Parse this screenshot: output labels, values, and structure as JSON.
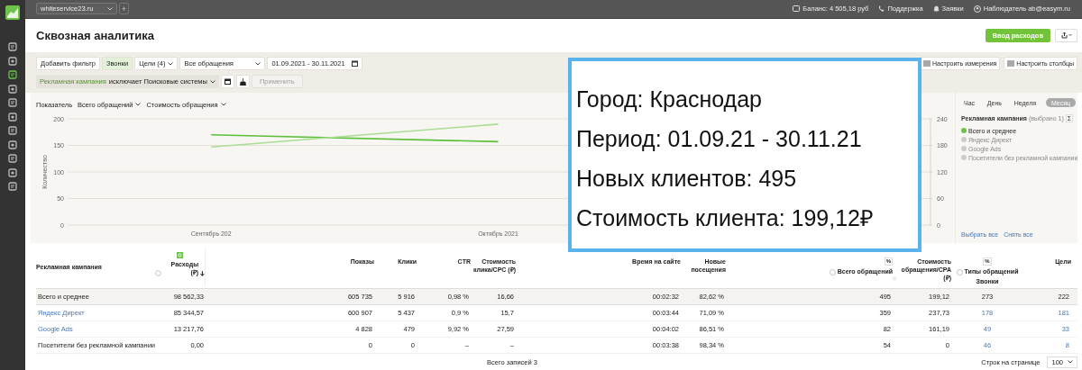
{
  "topbar": {
    "site": "whiteservice23.ru",
    "add": "+",
    "balance": "Баланс:  4 505,18 руб",
    "support": "Поддержка",
    "requests": "Заявки",
    "user": "Наблюдатель ab@easym.ru"
  },
  "sidebar": {
    "items": [
      {
        "selected": false
      },
      {
        "selected": false
      },
      {
        "selected": true
      },
      {
        "selected": false
      },
      {
        "selected": false
      },
      {
        "selected": false
      },
      {
        "selected": false
      },
      {
        "selected": false
      },
      {
        "selected": false
      },
      {
        "selected": false
      },
      {
        "selected": false
      }
    ]
  },
  "header": {
    "title": "Сквозная аналитика",
    "primary_button": "Ввод расходов"
  },
  "filters": {
    "add_filter": "Добавить фильтр",
    "calls": {
      "label": "Звонки",
      "selected": true
    },
    "goals": "Цели (4)",
    "requests_select": "Все обращения",
    "date_range": "01.09.2021 - 30.11.2021",
    "condition": {
      "field": "Рекламная кампания",
      "rest": "исключает Поисковые системы"
    },
    "apply": {
      "label": "Применить",
      "disabled": true
    },
    "configure": [
      "Настроить измерения",
      "Настроить столбцы"
    ]
  },
  "chart": {
    "indicator_label": "Показатель",
    "chart_data": {
      "type": "line",
      "ylabel": "Количество",
      "categories": [
        "Сентябрь 202",
        "Октябрь 2021",
        null
      ],
      "ylim": [
        0,
        200
      ],
      "yticks": [
        0,
        50,
        100,
        150,
        200
      ],
      "y2lim": [
        0,
        240
      ],
      "y2ticks": [
        0,
        60,
        120,
        180,
        240
      ],
      "grid": true,
      "series": [
        {
          "name": "Всего обращений",
          "color": "#5cbf3a",
          "values": [
            170,
            157,
            null
          ]
        },
        {
          "name": "Стоимость обращения",
          "color": "#a9de93",
          "values": [
            147,
            190,
            null
          ]
        }
      ]
    },
    "periods": [
      {
        "label": "Час",
        "selected": false
      },
      {
        "label": "День",
        "selected": false
      },
      {
        "label": "Неделя",
        "selected": false
      },
      {
        "label": "Месяц",
        "selected": true
      }
    ],
    "legend": {
      "title": "Рекламная кампания",
      "count": "(выбрано 1)",
      "sum": "Σ",
      "items": [
        {
          "label": "Всего и среднее",
          "on": true,
          "color": "#6cc24a"
        },
        {
          "label": "Яндекс Директ",
          "on": false,
          "color": "#cccccc"
        },
        {
          "label": "Google Ads",
          "on": false,
          "color": "#cccccc"
        },
        {
          "label": "Посетители без рекламной кампании",
          "on": false,
          "color": "#cccccc"
        }
      ]
    },
    "select_all": "Выбрать все",
    "clear_all": "Снять все"
  },
  "overlay": {
    "lines": [
      "Город: Краснодар",
      "Период: 01.09.21 - 30.11.21",
      "Новых клиентов: 495",
      "Стоимость клиента: 199,12₽"
    ]
  },
  "table": {
    "columns": [
      {
        "label": "Рекламная кампания",
        "help": false,
        "sorted": false
      },
      {
        "label": "Расходы (₽)",
        "help": true,
        "sorted": true,
        "badge": true
      },
      {
        "label": "Показы",
        "help": false,
        "sorted": false
      },
      {
        "label": "Клики",
        "help": false,
        "sorted": false
      },
      {
        "label": "CTR",
        "help": false,
        "sorted": false
      },
      {
        "label": "Стоимость клика/CPC (₽)",
        "help": false,
        "sorted": false
      },
      {
        "label": "Время на сайте",
        "help": false,
        "sorted": false
      },
      {
        "label": "Новые посещения",
        "help": false,
        "sorted": false
      },
      {
        "label": "Всего обращений",
        "help": true,
        "sorted": false,
        "toggle": "%"
      },
      {
        "label": "Стоимость обращения/CPA (₽)",
        "help": true,
        "sorted": false
      },
      {
        "label": "Звонки",
        "group": "Типы обращений",
        "help": true,
        "sorted": false,
        "toggle": "%"
      },
      {
        "label": "Цели",
        "help": false,
        "sorted": false
      }
    ],
    "rows": [
      {
        "kind": "total",
        "link": false,
        "cells": [
          "Всего и среднее",
          "98 562,33",
          "605 735",
          "5 916",
          "0,98 %",
          "16,66",
          "00:02:32",
          "82,62 %",
          "495",
          "199,12",
          "273",
          "222"
        ]
      },
      {
        "kind": "item",
        "link": true,
        "cells": [
          "Яндекс Директ",
          "85 344,57",
          "600 907",
          "5 437",
          "0,9 %",
          "15,7",
          "00:03:44",
          "71,09 %",
          "359",
          "237,73",
          "178",
          "181"
        ]
      },
      {
        "kind": "item",
        "link": true,
        "cells": [
          "Google Ads",
          "13 217,76",
          "4 828",
          "479",
          "9,92 %",
          "27,59",
          "00:04:02",
          "86,51 %",
          "82",
          "161,19",
          "49",
          "33"
        ]
      },
      {
        "kind": "item",
        "link": false,
        "cells": [
          "Посетители без рекламной кампании",
          "0,00",
          "0",
          "0",
          "–",
          "–",
          "00:03:38",
          "98,34 %",
          "54",
          "0",
          "46",
          "8"
        ]
      }
    ]
  },
  "footer": {
    "total": "Всего записей 3",
    "per_page_label": "Строк на странице",
    "per_page": "100"
  }
}
